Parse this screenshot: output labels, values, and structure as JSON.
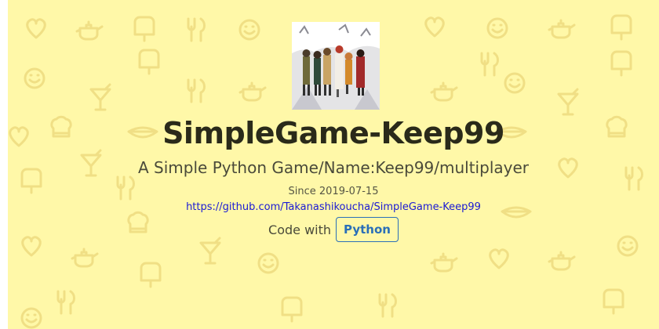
{
  "project": {
    "title": "SimpleGame-Keep99",
    "subtitle": "A Simple Python Game/Name:Keep99/multiplayer",
    "since": "Since 2019-07-15",
    "repo_url": "https://github.com/Takanashikoucha/SimpleGame-Keep99",
    "code_with_label": "Code with",
    "language_badge": "Python"
  },
  "colors": {
    "background": "#fff8a8",
    "pattern": "#ebd77a",
    "title": "#2a2a1a",
    "link": "#1a1ad4",
    "badge": "#2a6fb8"
  },
  "icons": [
    "heart-icon",
    "teapot-icon",
    "popsicle-icon",
    "fork-knife-icon",
    "cocktail-icon",
    "smiley-icon",
    "chef-hat-icon",
    "hotdog-icon"
  ]
}
